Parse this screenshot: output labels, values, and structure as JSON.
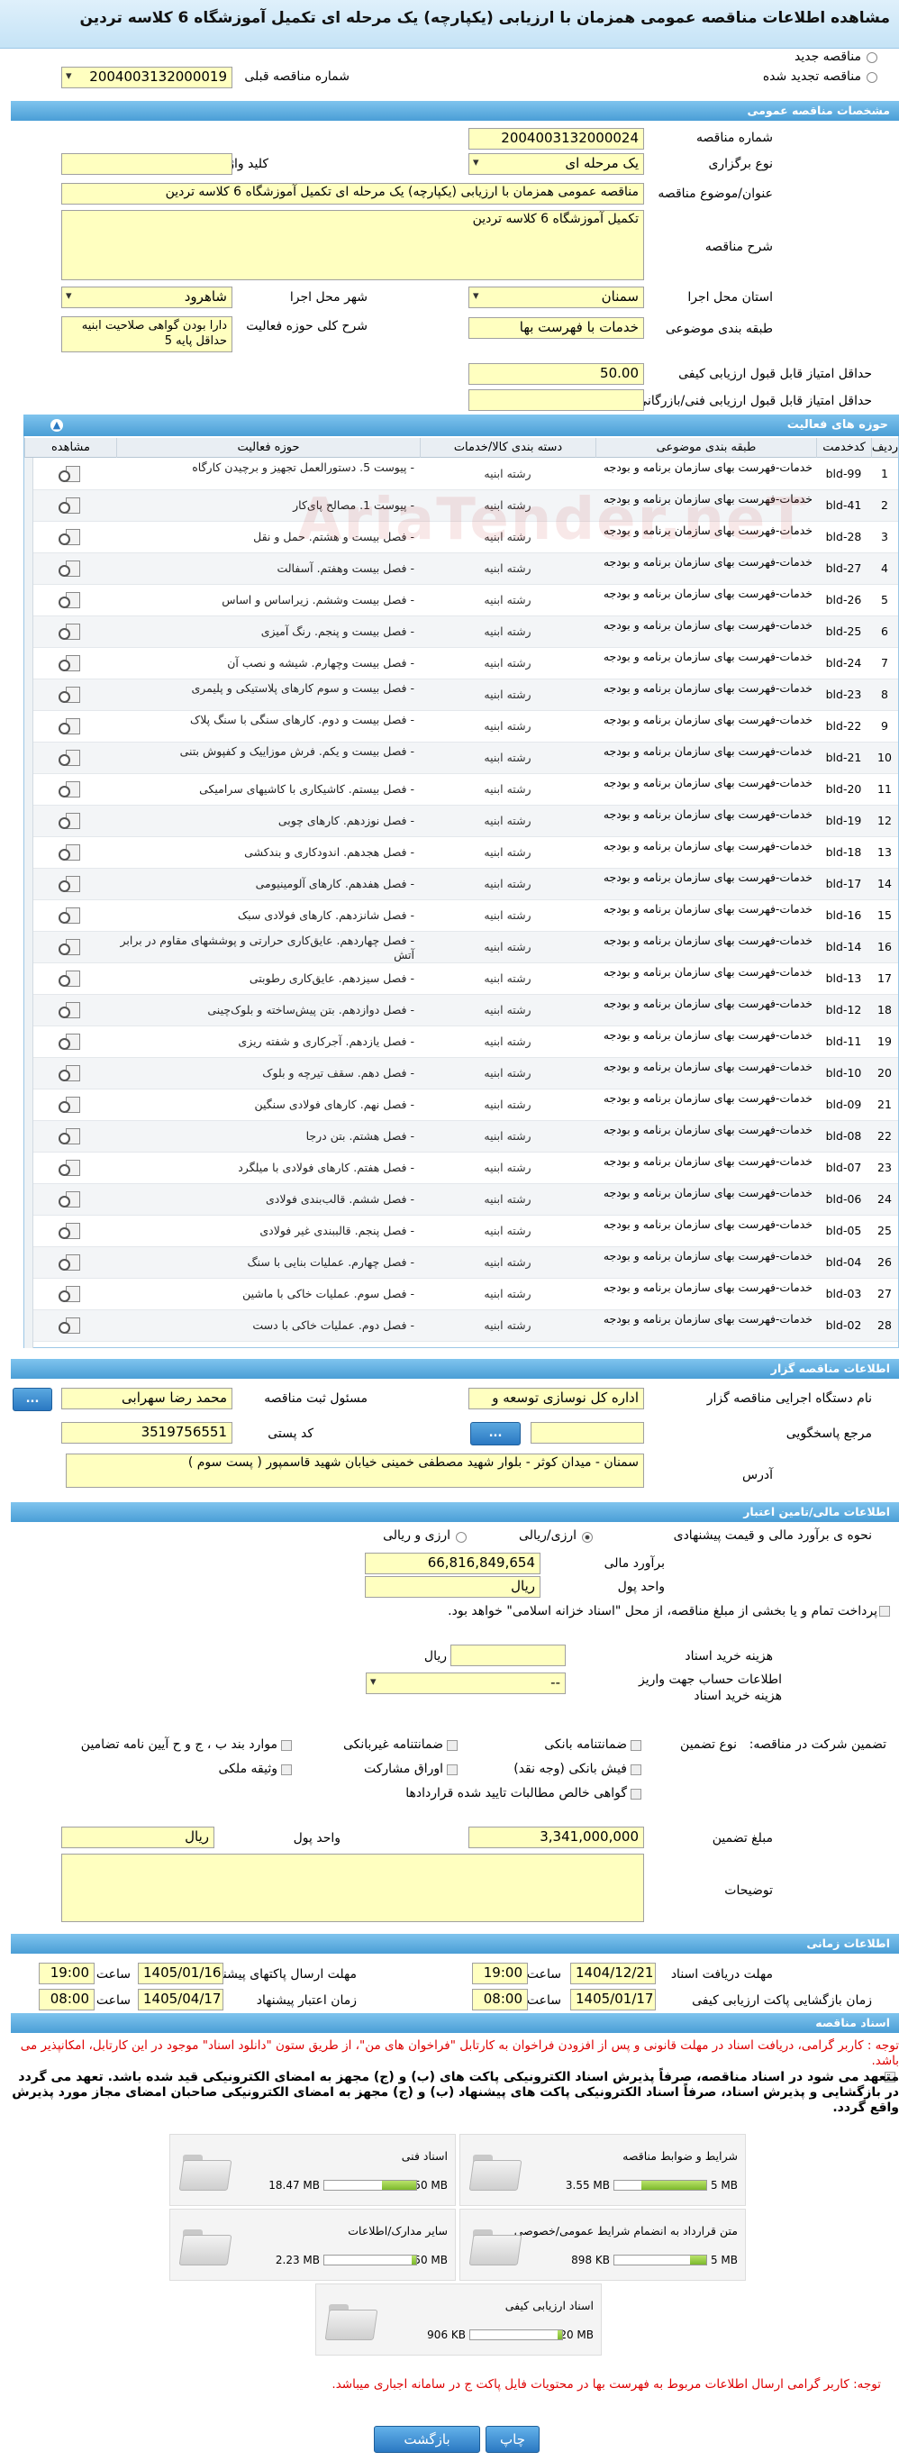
{
  "page_title": "مشاهده اطلاعات مناقصه عمومی همزمان با ارزیابی (یکپارچه) یک مرحله ای تکمیل آموزشگاه 6 کلاسه تردین",
  "tender_type": {
    "new_label": "مناقصه جدید",
    "renewed_label": "مناقصه تجدید شده",
    "previous_number_label": "شماره مناقصه قبلی",
    "previous_number": "2004003132000019"
  },
  "sections": {
    "tender_specs": "مشخصات مناقصه عمومی",
    "activity_areas": "حوزه های فعالیت",
    "organizer_info": "اطلاعات مناقصه گزار",
    "financial": "اطلاعات مالی/تامین اعتبار",
    "timing": "اطلاعات زمانی",
    "documents": "اسناد مناقصه"
  },
  "specs": {
    "tender_number_label": "شماره مناقصه",
    "tender_number": "2004003132000024",
    "holding_type_label": "نوع برگزاری",
    "holding_type": "یک مرحله ای",
    "keyword_label": "کلید واژه",
    "keyword": "",
    "subject_label": "عنوان/موضوع مناقصه",
    "subject": "مناقصه عمومی همزمان با ارزیابی (یکپارچه) یک مرحله ای تکمیل آموزشگاه 6 کلاسه تردین",
    "description_label": "شرح مناقصه",
    "description": "تکمیل آموزشگاه 6 کلاسه تردین",
    "province_label": "استان محل اجرا",
    "province": "سمنان",
    "city_label": "شهر محل اجرا",
    "city": "شاهرود",
    "category_label": "طبقه بندی موضوعی",
    "category": "خدمات با فهرست بها",
    "activity_desc_label": "شرح کلی حوزه فعالیت",
    "activity_desc": "دارا بودن گواهی صلاحیت ابنیه حداقل پایه 5",
    "min_quality_label": "حداقل امتیاز قابل قبول ارزیابی کیفی",
    "min_quality": "50.00",
    "min_tech_label": "حداقل امتیاز قابل قبول ارزیابی فنی/بازرگانی",
    "min_tech": ""
  },
  "grid": {
    "headers": [
      "ردیف",
      "کدخدمت",
      "طبقه بندی موضوعی",
      "دسته بندی کالا/خدمات",
      "حوزه فعالیت",
      "مشاهده"
    ],
    "rows": [
      {
        "n": "1",
        "code": "bld-99",
        "cat": "خدمات-فهرست بهای سازمان برنامه و بودجه",
        "grp": "رشته ابنیه",
        "act": "- پیوست 5. دستورالعمل تجهیز و برچیدن کارگاه"
      },
      {
        "n": "2",
        "code": "bld-41",
        "cat": "خدمات-فهرست بهای سازمان برنامه و بودجه",
        "grp": "رشته ابنیه",
        "act": "- پیوست 1. مصالح پای‌کار"
      },
      {
        "n": "3",
        "code": "bld-28",
        "cat": "خدمات-فهرست بهای سازمان برنامه و بودجه",
        "grp": "رشته ابنیه",
        "act": "- فصل بیست و هشتم. حمل و نقل"
      },
      {
        "n": "4",
        "code": "bld-27",
        "cat": "خدمات-فهرست بهای سازمان برنامه و بودجه",
        "grp": "رشته ابنیه",
        "act": "- فصل بیست وهفتم. آسفالت"
      },
      {
        "n": "5",
        "code": "bld-26",
        "cat": "خدمات-فهرست بهای سازمان برنامه و بودجه",
        "grp": "رشته ابنیه",
        "act": "- فصل بیست وششم. زیراساس و اساس"
      },
      {
        "n": "6",
        "code": "bld-25",
        "cat": "خدمات-فهرست بهای سازمان برنامه و بودجه",
        "grp": "رشته ابنیه",
        "act": "- فصل بیست و پنجم. رنگ آمیزی"
      },
      {
        "n": "7",
        "code": "bld-24",
        "cat": "خدمات-فهرست بهای سازمان برنامه و بودجه",
        "grp": "رشته ابنیه",
        "act": "- فصل بیست وچهارم. شیشه و نصب آن"
      },
      {
        "n": "8",
        "code": "bld-23",
        "cat": "خدمات-فهرست بهای سازمان برنامه و بودجه",
        "grp": "رشته ابنیه",
        "act": "- فصل بیست و سوم کارهای پلاستیکی و پلیمری"
      },
      {
        "n": "9",
        "code": "bld-22",
        "cat": "خدمات-فهرست بهای سازمان برنامه و بودجه",
        "grp": "رشته ابنیه",
        "act": "- فصل بیست و دوم. کارهای سنگی با سنگ پلاک"
      },
      {
        "n": "10",
        "code": "bld-21",
        "cat": "خدمات-فهرست بهای سازمان برنامه و بودجه",
        "grp": "رشته ابنیه",
        "act": "- فصل بیست و یکم. فرش موزاییک و کفپوش بتنی"
      },
      {
        "n": "11",
        "code": "bld-20",
        "cat": "خدمات-فهرست بهای سازمان برنامه و بودجه",
        "grp": "رشته ابنیه",
        "act": "- فصل بیستم. کاشیکاری با کاشیهای سرامیکی"
      },
      {
        "n": "12",
        "code": "bld-19",
        "cat": "خدمات-فهرست بهای سازمان برنامه و بودجه",
        "grp": "رشته ابنیه",
        "act": "- فصل نوزدهم. کارهای چوبی"
      },
      {
        "n": "13",
        "code": "bld-18",
        "cat": "خدمات-فهرست بهای سازمان برنامه و بودجه",
        "grp": "رشته ابنیه",
        "act": "- فصل هجدهم. اندودکاری و بندکشی"
      },
      {
        "n": "14",
        "code": "bld-17",
        "cat": "خدمات-فهرست بهای سازمان برنامه و بودجه",
        "grp": "رشته ابنیه",
        "act": "- فصل هفدهم. کارهای آلومینیومی"
      },
      {
        "n": "15",
        "code": "bld-16",
        "cat": "خدمات-فهرست بهای سازمان برنامه و بودجه",
        "grp": "رشته ابنیه",
        "act": "- فصل شانزدهم. کارهای فولادی سبک"
      },
      {
        "n": "16",
        "code": "bld-14",
        "cat": "خدمات-فهرست بهای سازمان برنامه و بودجه",
        "grp": "رشته ابنیه",
        "act": "- فصل چهاردهم. عایق‌کاری حرارتی و پوششهای مقاوم در برابر آتش"
      },
      {
        "n": "17",
        "code": "bld-13",
        "cat": "خدمات-فهرست بهای سازمان برنامه و بودجه",
        "grp": "رشته ابنیه",
        "act": "- فصل سیزدهم. عایق‌کاری رطوبتی"
      },
      {
        "n": "18",
        "code": "bld-12",
        "cat": "خدمات-فهرست بهای سازمان برنامه و بودجه",
        "grp": "رشته ابنیه",
        "act": "- فصل دوازدهم. بتن پیش‌ساخته و بلوک‌چینی"
      },
      {
        "n": "19",
        "code": "bld-11",
        "cat": "خدمات-فهرست بهای سازمان برنامه و بودجه",
        "grp": "رشته ابنیه",
        "act": "- فصل یازدهم. آجرکاری و شفته ریزی"
      },
      {
        "n": "20",
        "code": "bld-10",
        "cat": "خدمات-فهرست بهای سازمان برنامه و بودجه",
        "grp": "رشته ابنیه",
        "act": "- فصل دهم. سقف تیرچه و بلوک"
      },
      {
        "n": "21",
        "code": "bld-09",
        "cat": "خدمات-فهرست بهای سازمان برنامه و بودجه",
        "grp": "رشته ابنیه",
        "act": "- فصل نهم. کارهای فولادی سنگین"
      },
      {
        "n": "22",
        "code": "bld-08",
        "cat": "خدمات-فهرست بهای سازمان برنامه و بودجه",
        "grp": "رشته ابنیه",
        "act": "- فصل هشتم. بتن درجا"
      },
      {
        "n": "23",
        "code": "bld-07",
        "cat": "خدمات-فهرست بهای سازمان برنامه و بودجه",
        "grp": "رشته ابنیه",
        "act": "- فصل هفتم. کارهای فولادی با میلگرد"
      },
      {
        "n": "24",
        "code": "bld-06",
        "cat": "خدمات-فهرست بهای سازمان برنامه و بودجه",
        "grp": "رشته ابنیه",
        "act": "- فصل ششم. قالب‌بندی فولادی"
      },
      {
        "n": "25",
        "code": "bld-05",
        "cat": "خدمات-فهرست بهای سازمان برنامه و بودجه",
        "grp": "رشته ابنیه",
        "act": "- فصل پنجم. قالببندی غیر فولادی"
      },
      {
        "n": "26",
        "code": "bld-04",
        "cat": "خدمات-فهرست بهای سازمان برنامه و بودجه",
        "grp": "رشته ابنیه",
        "act": "- فصل چهارم. عملیات بنایی با سنگ"
      },
      {
        "n": "27",
        "code": "bld-03",
        "cat": "خدمات-فهرست بهای سازمان برنامه و بودجه",
        "grp": "رشته ابنیه",
        "act": "- فصل سوم. عملیات خاکی با ماشین"
      },
      {
        "n": "28",
        "code": "bld-02",
        "cat": "خدمات-فهرست بهای سازمان برنامه و بودجه",
        "grp": "رشته ابنیه",
        "act": "- فصل دوم. عملیات خاکی با دست"
      }
    ]
  },
  "organizer": {
    "executor_label": "نام دستگاه اجرایی مناقصه گزار",
    "executor": "اداره کل نوسازی   توسعه و",
    "responsible_label": "مسئول ثبت مناقصه",
    "responsible": "محمد رضا  سهرابی",
    "reference_label": "مرجع پاسخگویی",
    "reference": "",
    "postal_label": "کد پستی",
    "postal": "3519756551",
    "address_label": "آدرس",
    "address": "سمنان - میدان کوثر - بلوار شهید مصطفی خمینی خیابان شهید قاسمپور ( پست سوم )",
    "button_label": "..."
  },
  "financial": {
    "estimate_method_label": "نحوه ی برآورد مالی و قیمت پیشنهادی",
    "option_currency_rial": "ارزی/ریالی",
    "option_currency_and_rial": "ارزی و ریالی",
    "estimate_label": "برآورد مالی",
    "estimate": "66,816,849,654",
    "unit_label": "واحد پول",
    "unit": "ریال",
    "pay_note": "پرداخت تمام و یا بخشی از مبلغ مناقصه، از محل \"اسناد خزانه اسلامی\" خواهد بود.",
    "doc_fee_label": "هزینه خرید اسناد",
    "doc_fee": "",
    "doc_fee_unit": "ریال",
    "account_label": "اطلاعات حساب جهت واریز هزینه خرید اسناد",
    "account_value": "--",
    "participation_label": "تضمین شرکت در مناقصه:",
    "guarantee_type_label": "نوع تضمین",
    "guarantees": [
      "ضمانتنامه بانکی",
      "ضمانتنامه غیربانکی",
      "موارد بند ب ، ج و ح آیین نامه تضامین",
      "فیش بانکی (وجه نقد)",
      "اوراق مشارکت",
      "وثیقه ملکی",
      "گواهی خالص مطالبات تایید شده قراردادها"
    ],
    "guarantee_amount_label": "مبلغ تضمین",
    "guarantee_amount": "3,341,000,000",
    "guarantee_unit_label": "واحد پول",
    "guarantee_unit": "ریال",
    "notes_label": "توضیحات",
    "notes": ""
  },
  "timing": {
    "doc_receive_label": "مهلت دریافت اسناد",
    "doc_receive_date": "1404/12/21",
    "doc_receive_time": "19:00",
    "send_label": "مهلت ارسال پاکتهای پیشنهاد",
    "send_date": "1405/01/16",
    "send_time": "19:00",
    "open_label": "زمان بازگشایی پاکت ارزیابی کیفی",
    "open_date": "1405/01/17",
    "open_time": "08:00",
    "validity_label": "زمان اعتبار پیشنهاد",
    "validity_date": "1405/04/17",
    "validity_time": "08:00",
    "time_label": "ساعت"
  },
  "documents": {
    "note_red": "توجه : کاربر گرامی، دریافت اسناد در مهلت قانونی و پس از افزودن فراخوان به کارتابل \"فراخوان های من\"، از طریق ستون \"دانلود اسناد\" موجود در این کارتابل، امکانپذیر می باشد.",
    "note_black": "متعهد می شود در اسناد مناقصه، صرفاً پذیرش اسناد الکترونیکی پاکت های (ب) و (ج) مجهز به امضای الکترونیکی قید شده باشد. تعهد می گردد در بازگشایی و پذیرش اسناد، صرفاً اسناد الکترونیکی پاکت های پیشنهاد (ب) و (ج) مجهز به امضای الکترونیکی صاحبان امضای مجاز مورد پذیرش واقع گردد.",
    "items": [
      {
        "name": "شرایط و ضوابط مناقصه",
        "used": "3.55 MB",
        "max": "5 MB",
        "pct": 0.71
      },
      {
        "name": "اسناد فنی",
        "used": "18.47 MB",
        "max": "50 MB",
        "pct": 0.37
      },
      {
        "name": "متن قرارداد به انضمام شرایط عمومی/خصوصی",
        "used": "898 KB",
        "max": "5 MB",
        "pct": 0.18
      },
      {
        "name": "سایر مدارک/اطلاعات",
        "used": "2.23 MB",
        "max": "50 MB",
        "pct": 0.05
      },
      {
        "name": "اسناد ارزیابی کیفی",
        "used": "906 KB",
        "max": "20 MB",
        "pct": 0.05
      }
    ],
    "note_bottom": "توجه: کاربر گرامی ارسال اطلاعات مربوط به فهرست بها در محتویات فایل پاکت ج در سامانه اجباری میباشد."
  },
  "footer": {
    "print_label": "چاپ",
    "back_label": "بازگشت"
  },
  "watermark": "AriaTender.neT",
  "colors": {
    "section_bar": "#4a9ed6",
    "field_bg": "#ffffc0",
    "note_red": "#dd0000"
  }
}
